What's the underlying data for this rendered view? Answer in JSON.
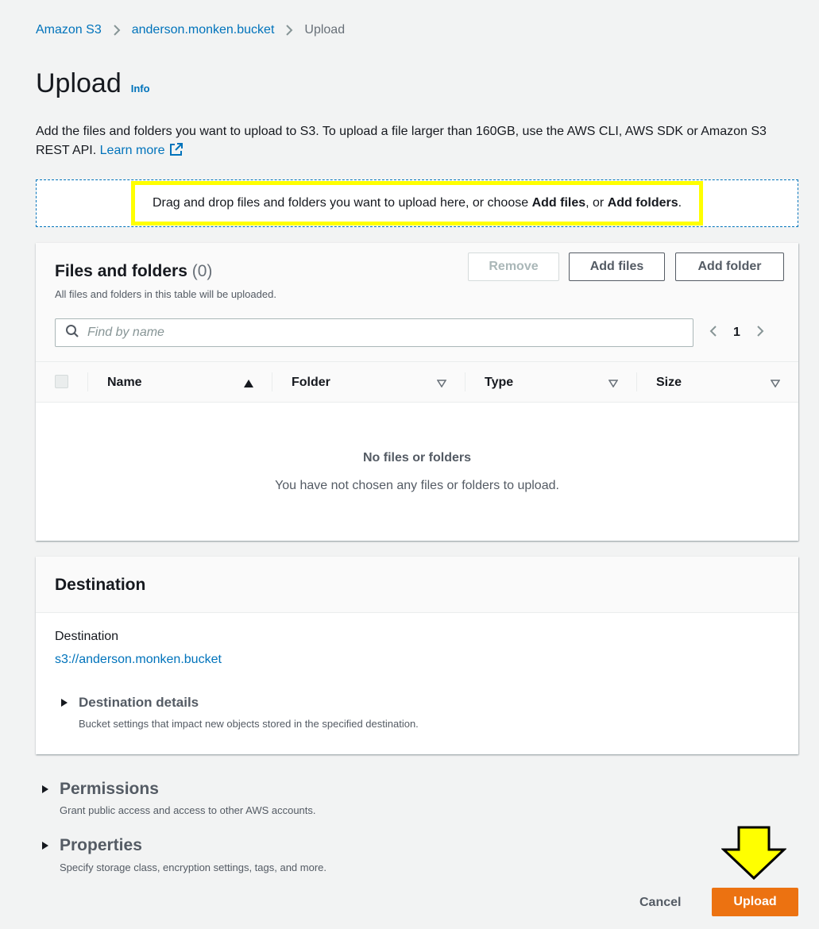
{
  "breadcrumb": {
    "items": [
      "Amazon S3",
      "anderson.monken.bucket"
    ],
    "current": "Upload"
  },
  "header": {
    "title": "Upload",
    "info_label": "Info",
    "intro_text": "Add the files and folders you want to upload to S3. To upload a file larger than 160GB, use the AWS CLI, AWS SDK or Amazon S3 REST API.",
    "learn_more": "Learn more"
  },
  "dropzone": {
    "prefix": "Drag and drop files and folders you want to upload here, or choose",
    "add_files": "Add files",
    "or": ", or",
    "add_folders": "Add folders",
    "suffix": ".",
    "highlight_color": "#ffff00"
  },
  "files_panel": {
    "title": "Files and folders",
    "count": "(0)",
    "subtitle": "All files and folders in this table will be uploaded.",
    "remove_label": "Remove",
    "add_files_label": "Add files",
    "add_folder_label": "Add folder",
    "search_placeholder": "Find by name",
    "page": "1",
    "columns": [
      "Name",
      "Folder",
      "Type",
      "Size"
    ],
    "empty_title": "No files or folders",
    "empty_message": "You have not chosen any files or folders to upload."
  },
  "destination": {
    "title": "Destination",
    "label": "Destination",
    "value": "s3://anderson.monken.bucket",
    "details_title": "Destination details",
    "details_desc": "Bucket settings that impact new objects stored in the specified destination."
  },
  "permissions": {
    "title": "Permissions",
    "desc": "Grant public access and access to other AWS accounts."
  },
  "properties": {
    "title": "Properties",
    "desc": "Specify storage class, encryption settings, tags, and more."
  },
  "footer": {
    "cancel_label": "Cancel",
    "upload_label": "Upload",
    "upload_color": "#ec7211"
  }
}
